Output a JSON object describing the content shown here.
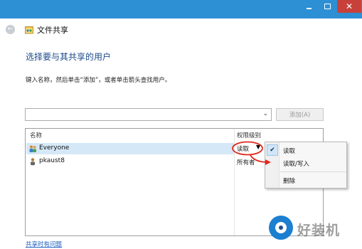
{
  "window": {
    "minimize_glyph": "",
    "maximize_glyph": "",
    "close_glyph": "✕"
  },
  "nav": {
    "back_glyph": "←",
    "title": "文件共享",
    "icon": "file-share-icon"
  },
  "main": {
    "heading": "选择要与其共享的用户",
    "instructions": "键入名称，然后单击“添加”，或者单击箭头查找用户。",
    "name_input": {
      "value": "",
      "arrow": "⌄"
    },
    "add_button": "添加(A)"
  },
  "table": {
    "headers": {
      "name": "名称",
      "permission": "权限级别"
    },
    "rows": [
      {
        "name": "Everyone",
        "permission": "读取",
        "icon": "group-icon",
        "selected": true
      },
      {
        "name": "pkaust8",
        "permission": "所有者",
        "icon": "user-icon",
        "selected": false
      }
    ],
    "perm_arrow": "▼"
  },
  "menu": {
    "check": "✔",
    "items": [
      "读取",
      "读取/写入",
      "删除"
    ],
    "checked_index": 0
  },
  "footer": {
    "help_link": "共享时有问题"
  },
  "watermark": {
    "text": "好装机"
  },
  "colors": {
    "titlebar": "#2d8fd4",
    "close": "#c7413a",
    "heading": "#1b4a8a",
    "selection": "#d5e8f7",
    "annotation": "#e02a20",
    "link": "#1f5fbf"
  }
}
